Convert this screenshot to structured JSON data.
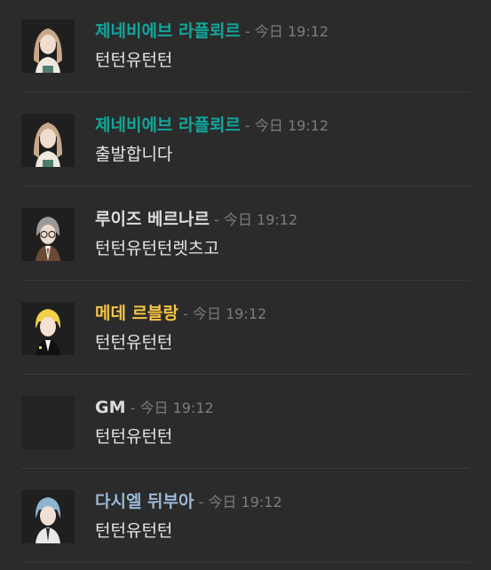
{
  "colors": {
    "background": "#2b2b2b",
    "divider": "#3a3a3a",
    "timestamp": "#7c7c7c",
    "message_text": "#e6e6e6"
  },
  "separator": "-",
  "messages": [
    {
      "author": "제네비에브 라플뢰르",
      "author_color": "#11a69a",
      "time": "今日 19:12",
      "text": "턴턴유턴턴",
      "avatar_icon": "character-portrait-long-hair-icon"
    },
    {
      "author": "제네비에브 라플뢰르",
      "author_color": "#11a69a",
      "time": "今日 19:12",
      "text": "출발합니다",
      "avatar_icon": "character-portrait-long-hair-icon"
    },
    {
      "author": "루이즈 베르나르",
      "author_color": "#dcdcdc",
      "time": "今日 19:12",
      "text": "턴턴유턴턴렛츠고",
      "avatar_icon": "character-portrait-glasses-icon"
    },
    {
      "author": "메데 르블랑",
      "author_color": "#f5c542",
      "time": "今日 19:12",
      "text": "턴턴유턴턴",
      "avatar_icon": "character-portrait-blonde-icon"
    },
    {
      "author": "GM",
      "author_color": "#dcdcdc",
      "time": "今日 19:12",
      "text": "턴턴유턴턴",
      "avatar_icon": "blank-avatar-icon"
    },
    {
      "author": "다시엘 뒤부아",
      "author_color": "#9bb9d6",
      "time": "今日 19:12",
      "text": "턴턴유턴턴",
      "avatar_icon": "character-portrait-blue-hair-icon"
    }
  ]
}
